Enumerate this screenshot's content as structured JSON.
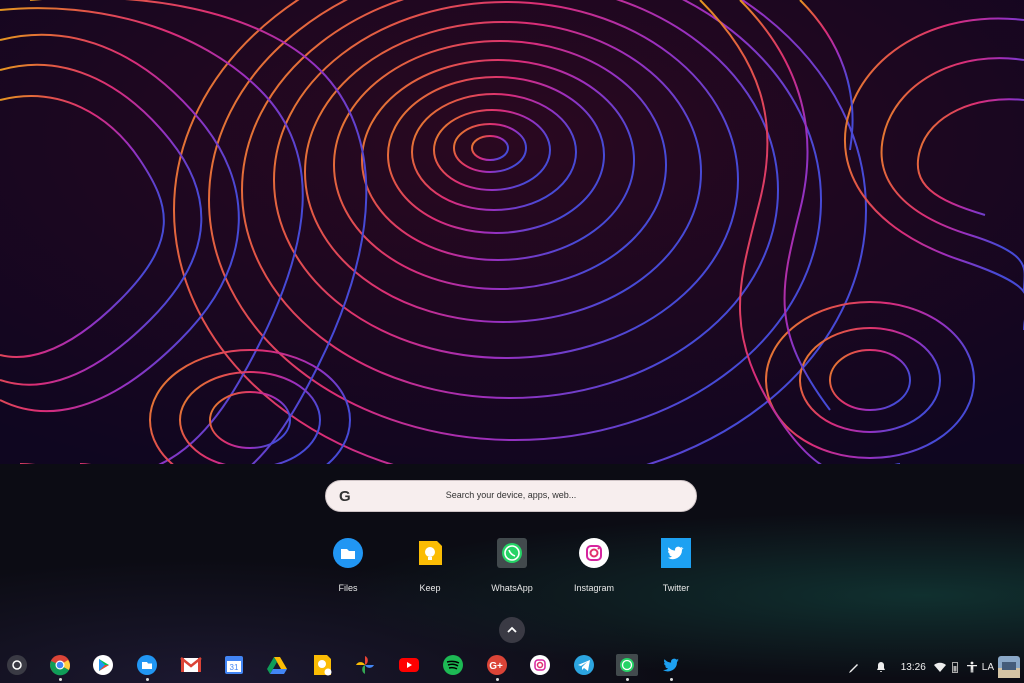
{
  "search": {
    "placeholder": "Search your device, apps, web..."
  },
  "apps": [
    {
      "label": "Files",
      "icon": "files-icon"
    },
    {
      "label": "Keep",
      "icon": "keep-icon"
    },
    {
      "label": "WhatsApp",
      "icon": "whatsapp-icon"
    },
    {
      "label": "Instagram",
      "icon": "instagram-icon"
    },
    {
      "label": "Twitter",
      "icon": "twitter-icon"
    }
  ],
  "shelf": {
    "items": [
      "launcher",
      "chrome",
      "play-store",
      "files",
      "gmail",
      "calendar",
      "drive",
      "keep",
      "photos",
      "youtube",
      "spotify",
      "google-plus",
      "instagram",
      "telegram",
      "whatsapp",
      "twitter"
    ],
    "calendar_day": "31"
  },
  "tray": {
    "time": "13:26",
    "locale": "LA"
  }
}
